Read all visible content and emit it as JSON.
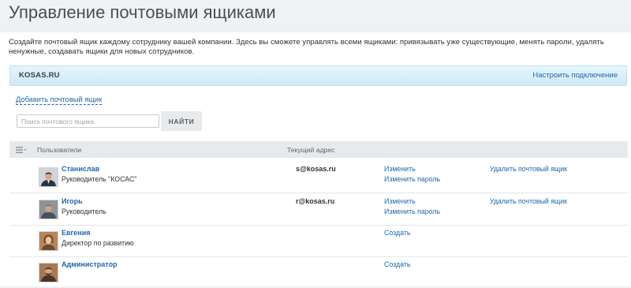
{
  "page": {
    "title": "Управление почтовыми ящиками",
    "intro": "Создайте почтовый ящик каждому сотруднику вашей компании. Здесь вы сможете управлять всеми ящиками: привязывать уже существующие, менять пароли, удалять ненужные, создавать ящики для новых сотрудников."
  },
  "domain": {
    "name": "KOSAS.RU",
    "configure_label": "Настроить подключение"
  },
  "controls": {
    "add_mailbox_label": "Добавить почтовый ящик",
    "search_placeholder": "Поиск почтового ящика",
    "find_label": "НАЙТИ"
  },
  "table": {
    "headers": {
      "users": "Пользователи",
      "address": "Текущий адрес"
    },
    "rows": [
      {
        "name": "Станислав",
        "position": "Руководитель \"КОСАС\"",
        "email": "s@kosas.ru",
        "action_primary": "Изменить",
        "action_secondary": "Изменить пароль",
        "action_delete": "Удалить почтовый ящик",
        "avatar_icon": "man-suit-photo"
      },
      {
        "name": "Игорь",
        "position": "Руководитель",
        "email": "r@kosas.ru",
        "action_primary": "Изменить",
        "action_secondary": "Изменить пароль",
        "action_delete": "Удалить почтовый ящик",
        "avatar_icon": "man-dark-photo"
      },
      {
        "name": "Евгения",
        "position": "Директор по развитию",
        "email": "",
        "action_primary": "Создать",
        "avatar_icon": "woman-photo"
      },
      {
        "name": "Администратор",
        "position": "",
        "email": "",
        "action_primary": "Создать",
        "avatar_icon": "man-beard-photo"
      }
    ]
  },
  "colors": {
    "link": "#2067b0",
    "background": "#eef2f4",
    "domain_bar": "#d9eff9",
    "table_header": "#e7eaec"
  }
}
